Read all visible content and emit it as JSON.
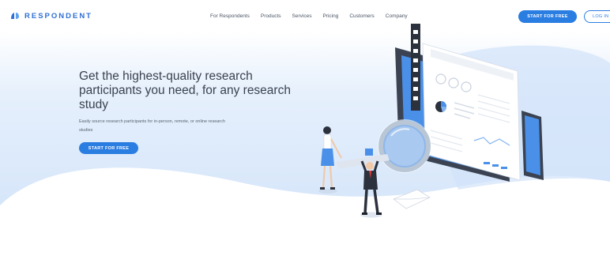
{
  "brand": {
    "name": "RESPONDENT"
  },
  "nav": {
    "items": [
      "For Respondents",
      "Products",
      "Services",
      "Pricing",
      "Customers",
      "Company"
    ]
  },
  "header": {
    "cta_label": "START FOR FREE",
    "login_label": "LOG IN"
  },
  "hero": {
    "title": "Get the highest-quality research participants you need, for any research study",
    "subtitle": "Easily source research participants for in-person, remote, or online research studies",
    "cta_label": "START FOR FREE"
  },
  "colors": {
    "accent": "#2a7de1",
    "brand": "#2f6fd6",
    "sky": "#dbe9fb",
    "text": "#3a4250"
  },
  "icons": {
    "logo": "respondent-logo-icon",
    "illustration": "research-magnifier-illustration"
  }
}
